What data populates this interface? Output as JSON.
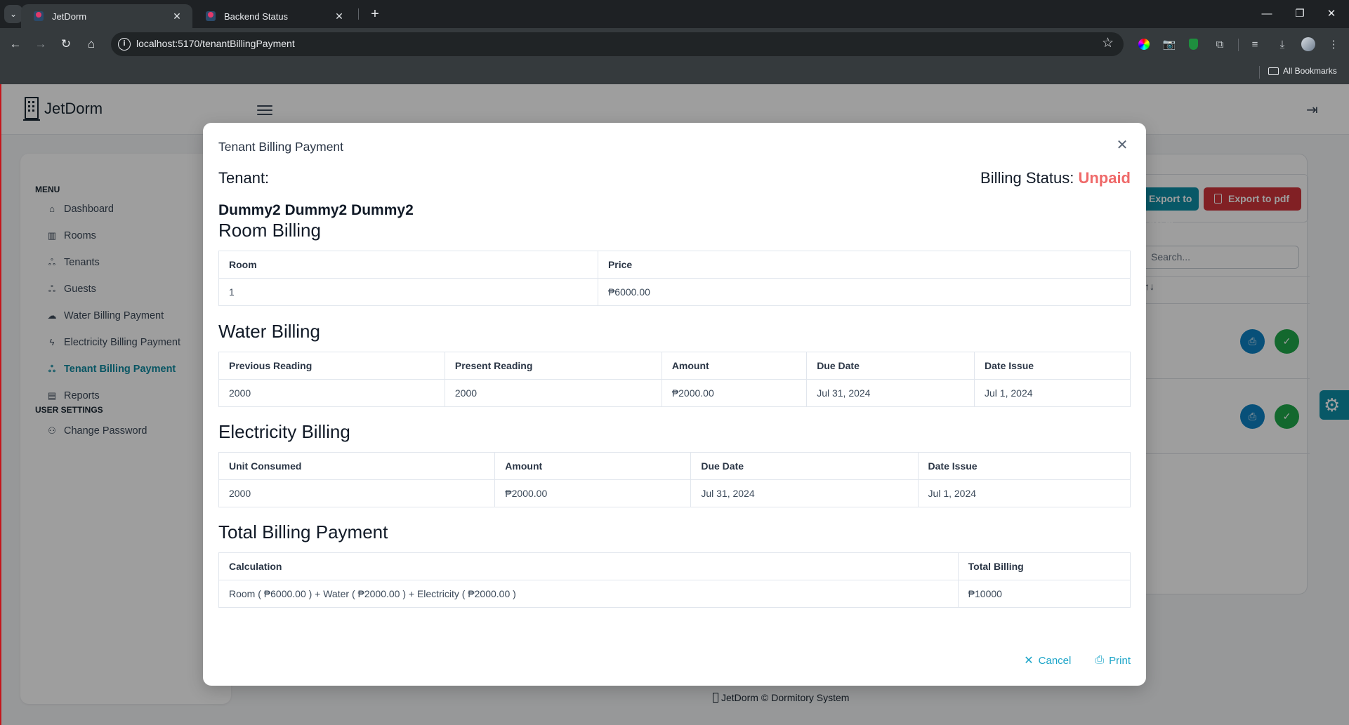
{
  "browser": {
    "tabs": [
      {
        "title": "JetDorm",
        "active": true
      },
      {
        "title": "Backend Status",
        "active": false
      }
    ],
    "url": "localhost:5170/tenantBillingPayment",
    "bookmarks_label": "All Bookmarks"
  },
  "app": {
    "brand": "JetDorm",
    "sidebar": {
      "menu_heading": "MENU",
      "items": [
        {
          "label": "Dashboard",
          "icon": "home-icon",
          "active": false
        },
        {
          "label": "Rooms",
          "icon": "building-icon",
          "active": false
        },
        {
          "label": "Tenants",
          "icon": "users-icon",
          "active": false
        },
        {
          "label": "Guests",
          "icon": "users-icon",
          "active": false
        },
        {
          "label": "Water Billing Payment",
          "icon": "cloud-icon",
          "active": false
        },
        {
          "label": "Electricity Billing Payment",
          "icon": "bolt-icon",
          "active": false
        },
        {
          "label": "Tenant Billing Payment",
          "icon": "users-icon",
          "active": true
        },
        {
          "label": "Reports",
          "icon": "book-icon",
          "active": false
        }
      ],
      "settings_heading": "USER SETTINGS",
      "settings_items": [
        {
          "label": "Change Password",
          "icon": "user-pen-icon"
        }
      ]
    },
    "background": {
      "export_excel_label": "Export to excel",
      "export_pdf_label": "Export to pdf",
      "search_placeholder": "Search...",
      "sort_glyph": "↑↓"
    },
    "footer": {
      "brand": "JetDorm",
      "copyright": "©",
      "text": "Dormitory System"
    }
  },
  "modal": {
    "title": "Tenant Billing Payment",
    "tenant_label": "Tenant:",
    "tenant_name": "Dummy2 Dummy2 Dummy2",
    "status_label": "Billing Status:",
    "status_value": "Unpaid",
    "status_color": "#ef6a6a",
    "room_billing": {
      "title": "Room Billing",
      "headers": [
        "Room",
        "Price"
      ],
      "rows": [
        [
          "1",
          "₱6000.00"
        ]
      ]
    },
    "water_billing": {
      "title": "Water Billing",
      "headers": [
        "Previous Reading",
        "Present Reading",
        "Amount",
        "Due Date",
        "Date Issue"
      ],
      "rows": [
        [
          "2000",
          "2000",
          "₱2000.00",
          "Jul 31, 2024",
          "Jul 1, 2024"
        ]
      ]
    },
    "electricity_billing": {
      "title": "Electricity Billing",
      "headers": [
        "Unit Consumed",
        "Amount",
        "Due Date",
        "Date Issue"
      ],
      "rows": [
        [
          "2000",
          "₱2000.00",
          "Jul 31, 2024",
          "Jul 1, 2024"
        ]
      ]
    },
    "total_billing": {
      "title": "Total Billing Payment",
      "headers": [
        "Calculation",
        "Total Billing"
      ],
      "rows": [
        [
          "Room ( ₱6000.00 ) + Water ( ₱2000.00 ) + Electricity ( ₱2000.00 )",
          "₱10000"
        ]
      ]
    },
    "cancel_label": "Cancel",
    "print_label": "Print"
  }
}
